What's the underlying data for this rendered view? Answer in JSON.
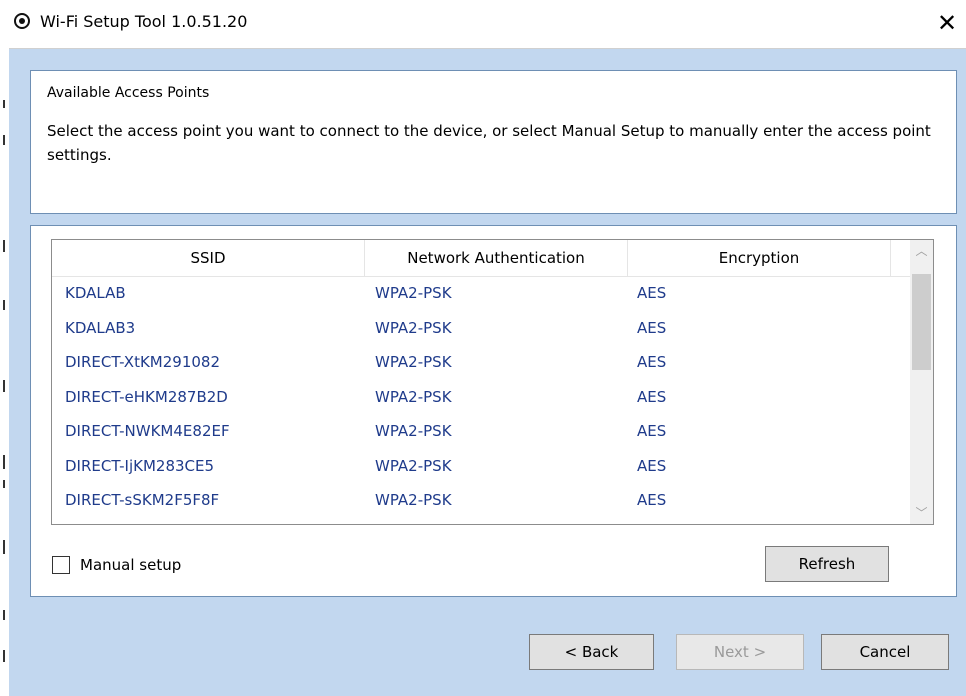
{
  "window": {
    "title": "Wi-Fi Setup Tool 1.0.51.20",
    "close_glyph": "✕"
  },
  "header_panel": {
    "heading": "Available Access Points",
    "description": "Select the access point you want to connect to the device, or select Manual Setup to manually enter the access point settings."
  },
  "ap_table": {
    "columns": [
      "SSID",
      "Network Authentication",
      "Encryption"
    ],
    "rows": [
      {
        "ssid": "KDALAB",
        "auth": "WPA2-PSK",
        "enc": "AES"
      },
      {
        "ssid": "KDALAB3",
        "auth": "WPA2-PSK",
        "enc": "AES"
      },
      {
        "ssid": "DIRECT-XtKM291082",
        "auth": "WPA2-PSK",
        "enc": "AES"
      },
      {
        "ssid": "DIRECT-eHKM287B2D",
        "auth": "WPA2-PSK",
        "enc": "AES"
      },
      {
        "ssid": "DIRECT-NWKM4E82EF",
        "auth": "WPA2-PSK",
        "enc": "AES"
      },
      {
        "ssid": "DIRECT-IjKM283CE5",
        "auth": "WPA2-PSK",
        "enc": "AES"
      },
      {
        "ssid": "DIRECT-sSKM2F5F8F",
        "auth": "WPA2-PSK",
        "enc": "AES"
      }
    ],
    "scroll_up_glyph": "︿",
    "scroll_down_glyph": "﹀"
  },
  "manual_setup": {
    "label": "Manual setup",
    "checked": false
  },
  "buttons": {
    "refresh": "Refresh",
    "back": "< Back",
    "next": "Next >",
    "cancel": "Cancel"
  },
  "icons": {
    "app": "radio-button-icon",
    "close": "close-icon"
  },
  "colors": {
    "window_bg": "#c2d7ef",
    "link_text": "#1f3b8b",
    "panel_border": "#6e8fb4"
  }
}
